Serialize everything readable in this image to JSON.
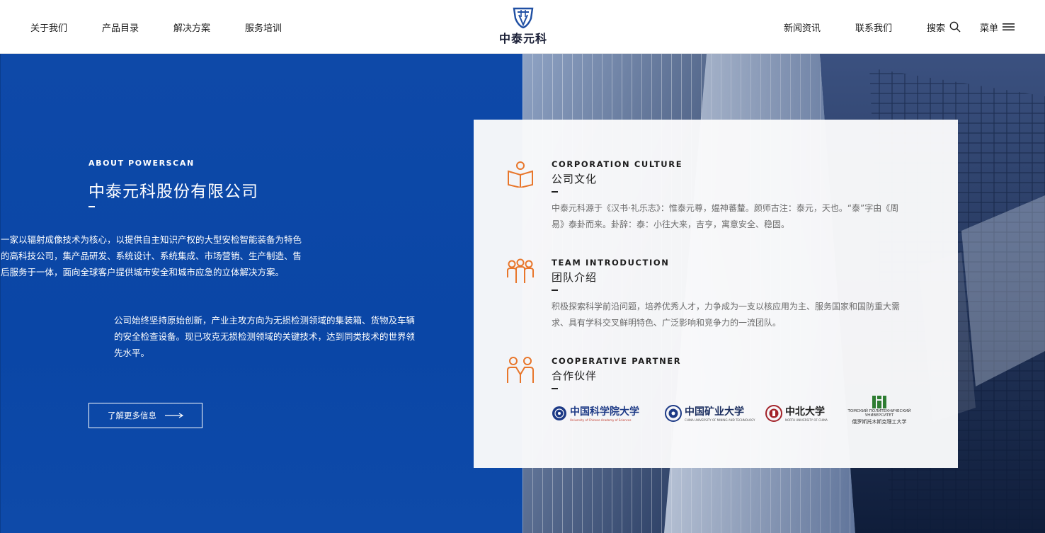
{
  "header": {
    "nav_left": [
      "关于我们",
      "产品目录",
      "解决方案",
      "服务培训"
    ],
    "logo_text": "中泰元科",
    "nav_right": [
      "新闻资讯",
      "联系我们"
    ],
    "search_label": "搜索",
    "menu_label": "菜单"
  },
  "about": {
    "eyebrow": "ABOUT POWERSCAN",
    "title": "中泰元科股份有限公司",
    "paragraphs": [
      "一家以辐射成像技术为核心，以提供自主知识产权的大型安检智能装备为特色的高科技公司，集产品研发、系统设计、系统集成、市场营销、生产制造、售后服务于一体，面向全球客户提供城市安全和城市应急的立体解决方案。",
      "公司始终坚持原始创新，产业主攻方向为无损检测领域的集装箱、货物及车辆的安全检查设备。现已攻克无损检测领域的关键技术，达到同类技术的世界领先水平。"
    ],
    "more_button": "了解更多信息"
  },
  "card": {
    "sections": [
      {
        "en": "CORPORATION CULTURE",
        "cn": "公司文化",
        "desc": "中泰元科源于《汉书·礼乐志》：惟泰元尊，媪神蕃釐。颜师古注：泰元，天也。“泰”字由《周易》泰卦而来。卦辞：泰：小往大来，吉亨，寓意安全、稳固。",
        "icon": "book-reader-icon"
      },
      {
        "en": "TEAM INTRODUCTION",
        "cn": "团队介绍",
        "desc": "积极探索科学前沿问题，培养优秀人才，力争成为一支以核应用为主、服务国家和国防重大需求、具有学科交叉鲜明特色、广泛影响和竞争力的一流团队。",
        "icon": "team-icon"
      },
      {
        "en": "COOPERATIVE PARTNER",
        "cn": "合作伙伴",
        "icon": "partner-icon"
      }
    ],
    "partners": [
      {
        "name": "中国科学院大学",
        "sub": "University of Chinese Academy of Sciences"
      },
      {
        "name": "中国矿业大学",
        "sub": "CHINA UNIVERSITY OF MINING AND TECHNOLOGY"
      },
      {
        "name": "中北大学",
        "sub": "NORTH UNIVERSITY OF CHINA"
      },
      {
        "name_ru": "ТОМСКИЙ ПОЛИТЕХНИЧЕСКИЙ УНИВЕРСИТЕТ",
        "name_zh": "俄罗斯托木斯克理工大学"
      }
    ]
  },
  "colors": {
    "brand_blue": "#0b47a7",
    "accent_orange": "#e8762b",
    "card_bg": "#fafafb"
  }
}
